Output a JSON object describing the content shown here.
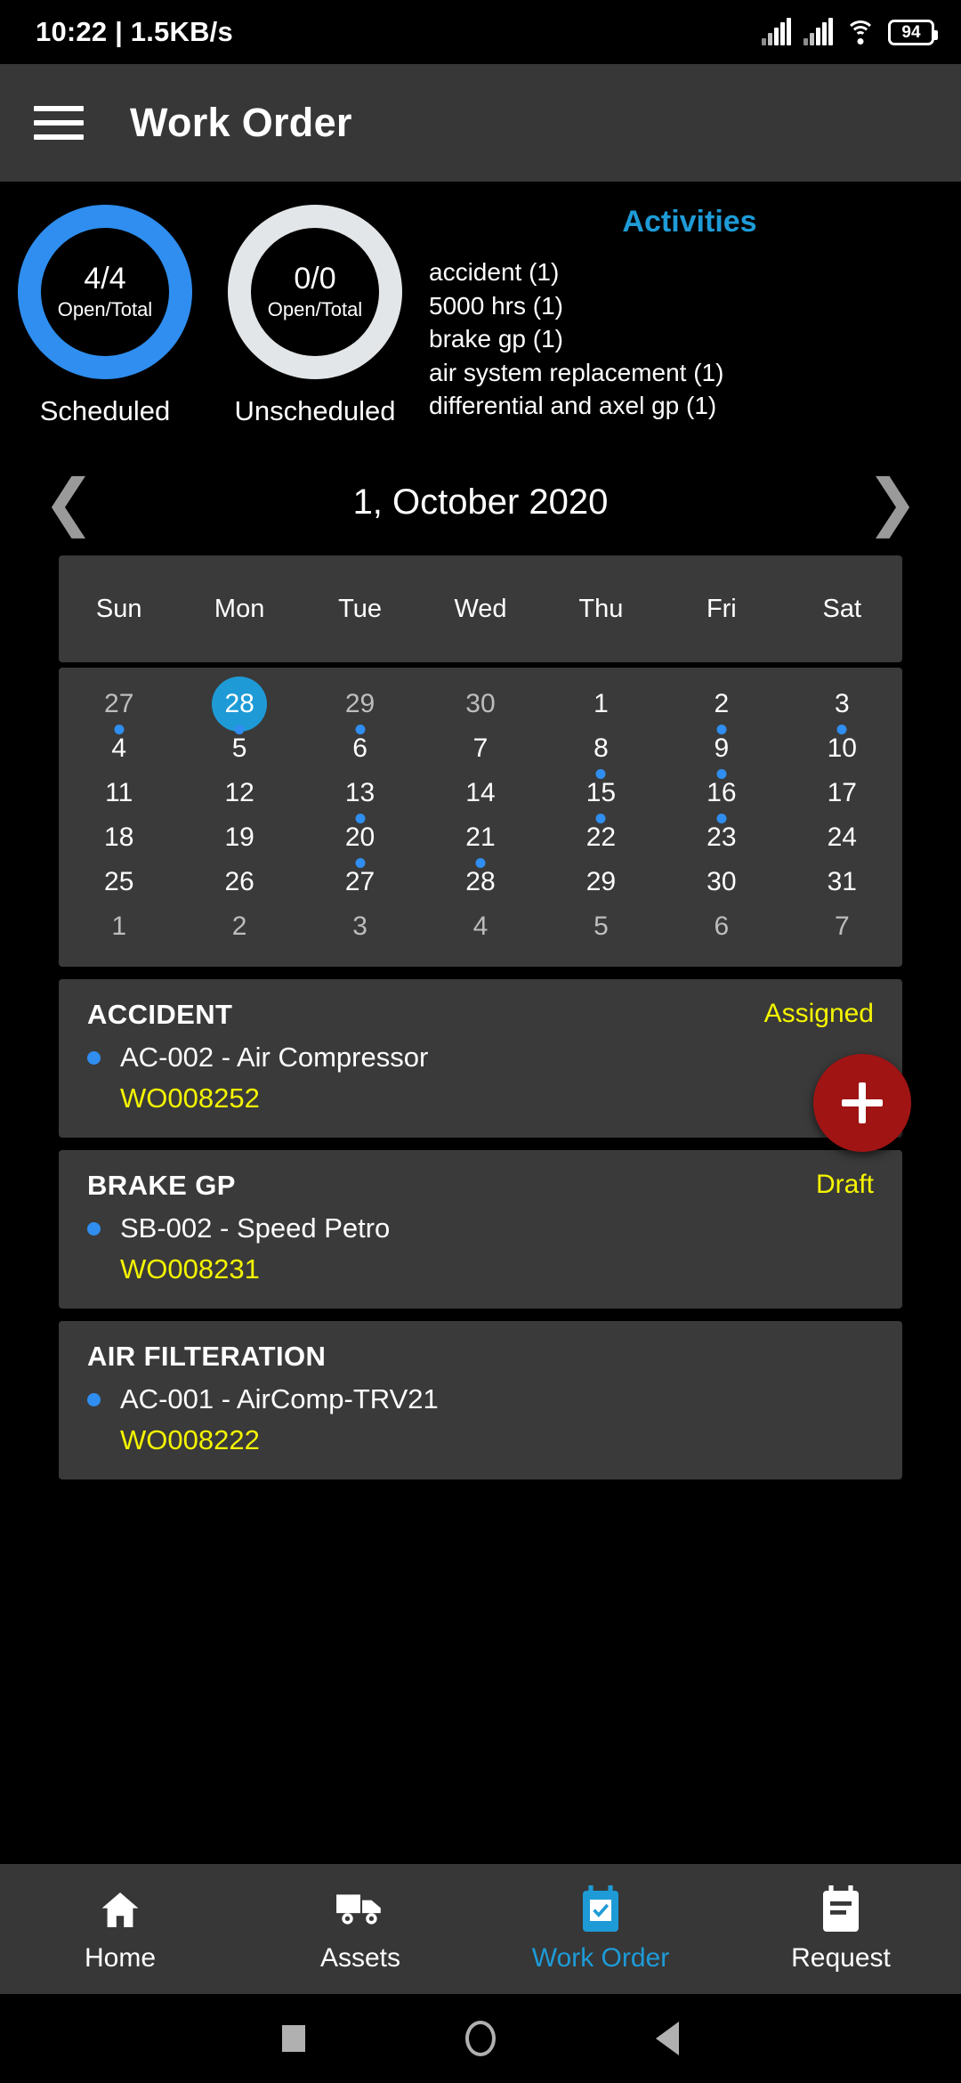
{
  "status_bar": {
    "time_and_speed": "10:22 | 1.5KB/s",
    "battery_level": "94",
    "icons": [
      "signal-bars-icon",
      "signal-bars-icon",
      "wifi-icon",
      "battery-icon"
    ]
  },
  "app_bar": {
    "menu_icon": "hamburger-menu-icon",
    "title": "Work Order"
  },
  "summary": {
    "donuts": [
      {
        "value": "4/4",
        "sub": "Open/Total",
        "label": "Scheduled",
        "color": "#2f8eef"
      },
      {
        "value": "0/0",
        "sub": "Open/Total",
        "label": "Unscheduled",
        "color": "#e3e6e8"
      }
    ],
    "activities_title": "Activities",
    "activities": [
      "accident (1)",
      "5000 hrs (1)",
      "brake gp (1)",
      "air system replacement (1)",
      "differential and axel gp (1)"
    ]
  },
  "month_nav": {
    "prev_icon": "chevron-left-icon",
    "next_icon": "chevron-right-icon",
    "title": "1, October 2020"
  },
  "calendar": {
    "weekdays": [
      "Sun",
      "Mon",
      "Tue",
      "Wed",
      "Thu",
      "Fri",
      "Sat"
    ],
    "selected_day": 28,
    "accent_color": "#1e9bd7",
    "dot_color": "#2f8eef",
    "rows": [
      [
        {
          "n": "27",
          "muted": true,
          "dot": false,
          "sel": false
        },
        {
          "n": "28",
          "muted": true,
          "dot": false,
          "sel": true
        },
        {
          "n": "29",
          "muted": true,
          "dot": false,
          "sel": false
        },
        {
          "n": "30",
          "muted": true,
          "dot": false,
          "sel": false
        },
        {
          "n": "1",
          "muted": false,
          "dot": false,
          "sel": false
        },
        {
          "n": "2",
          "muted": false,
          "dot": false,
          "sel": false
        },
        {
          "n": "3",
          "muted": false,
          "dot": false,
          "sel": false
        }
      ],
      [
        {
          "n": "4",
          "muted": false,
          "dot": true,
          "sel": false
        },
        {
          "n": "5",
          "muted": false,
          "dot": true,
          "sel": false
        },
        {
          "n": "6",
          "muted": false,
          "dot": true,
          "sel": false
        },
        {
          "n": "7",
          "muted": false,
          "dot": false,
          "sel": false
        },
        {
          "n": "8",
          "muted": false,
          "dot": false,
          "sel": false
        },
        {
          "n": "9",
          "muted": false,
          "dot": true,
          "sel": false
        },
        {
          "n": "10",
          "muted": false,
          "dot": true,
          "sel": false
        }
      ],
      [
        {
          "n": "11",
          "muted": false,
          "dot": false,
          "sel": false
        },
        {
          "n": "12",
          "muted": false,
          "dot": false,
          "sel": false
        },
        {
          "n": "13",
          "muted": false,
          "dot": false,
          "sel": false
        },
        {
          "n": "14",
          "muted": false,
          "dot": false,
          "sel": false
        },
        {
          "n": "15",
          "muted": false,
          "dot": true,
          "sel": false
        },
        {
          "n": "16",
          "muted": false,
          "dot": true,
          "sel": false
        },
        {
          "n": "17",
          "muted": false,
          "dot": false,
          "sel": false
        }
      ],
      [
        {
          "n": "18",
          "muted": false,
          "dot": false,
          "sel": false
        },
        {
          "n": "19",
          "muted": false,
          "dot": false,
          "sel": false
        },
        {
          "n": "20",
          "muted": false,
          "dot": true,
          "sel": false
        },
        {
          "n": "21",
          "muted": false,
          "dot": false,
          "sel": false
        },
        {
          "n": "22",
          "muted": false,
          "dot": true,
          "sel": false
        },
        {
          "n": "23",
          "muted": false,
          "dot": true,
          "sel": false
        },
        {
          "n": "24",
          "muted": false,
          "dot": false,
          "sel": false
        }
      ],
      [
        {
          "n": "25",
          "muted": false,
          "dot": false,
          "sel": false
        },
        {
          "n": "26",
          "muted": false,
          "dot": false,
          "sel": false
        },
        {
          "n": "27",
          "muted": false,
          "dot": true,
          "sel": false
        },
        {
          "n": "28",
          "muted": false,
          "dot": true,
          "sel": false
        },
        {
          "n": "29",
          "muted": false,
          "dot": false,
          "sel": false
        },
        {
          "n": "30",
          "muted": false,
          "dot": false,
          "sel": false
        },
        {
          "n": "31",
          "muted": false,
          "dot": false,
          "sel": false
        }
      ],
      [
        {
          "n": "1",
          "muted": true,
          "dot": false,
          "sel": false
        },
        {
          "n": "2",
          "muted": true,
          "dot": false,
          "sel": false
        },
        {
          "n": "3",
          "muted": true,
          "dot": false,
          "sel": false
        },
        {
          "n": "4",
          "muted": true,
          "dot": false,
          "sel": false
        },
        {
          "n": "5",
          "muted": true,
          "dot": false,
          "sel": false
        },
        {
          "n": "6",
          "muted": true,
          "dot": false,
          "sel": false
        },
        {
          "n": "7",
          "muted": true,
          "dot": false,
          "sel": false
        }
      ]
    ]
  },
  "work_orders": [
    {
      "title": "ACCIDENT",
      "status": "Assigned",
      "asset": "AC-002 - Air Compressor",
      "code": "WO008252"
    },
    {
      "title": "BRAKE GP",
      "status": "Draft",
      "asset": "SB-002 - Speed Petro",
      "code": "WO008231"
    },
    {
      "title": "AIR FILTERATION",
      "status": "",
      "asset": "AC-001 - AirComp-TRV21",
      "code": "WO008222"
    }
  ],
  "fab": {
    "icon": "plus-icon",
    "color": "#a01414"
  },
  "bottom_nav": {
    "active_color": "#1e9bd7",
    "items": [
      {
        "label": "Home",
        "icon": "home-icon",
        "active": false
      },
      {
        "label": "Assets",
        "icon": "truck-icon",
        "active": false
      },
      {
        "label": "Work Order",
        "icon": "clipboard-check-icon",
        "active": true
      },
      {
        "label": "Request",
        "icon": "clipboard-lines-icon",
        "active": false
      }
    ]
  },
  "system_nav": {
    "icons": [
      "recents-square-icon",
      "home-circle-icon",
      "back-triangle-icon"
    ]
  }
}
